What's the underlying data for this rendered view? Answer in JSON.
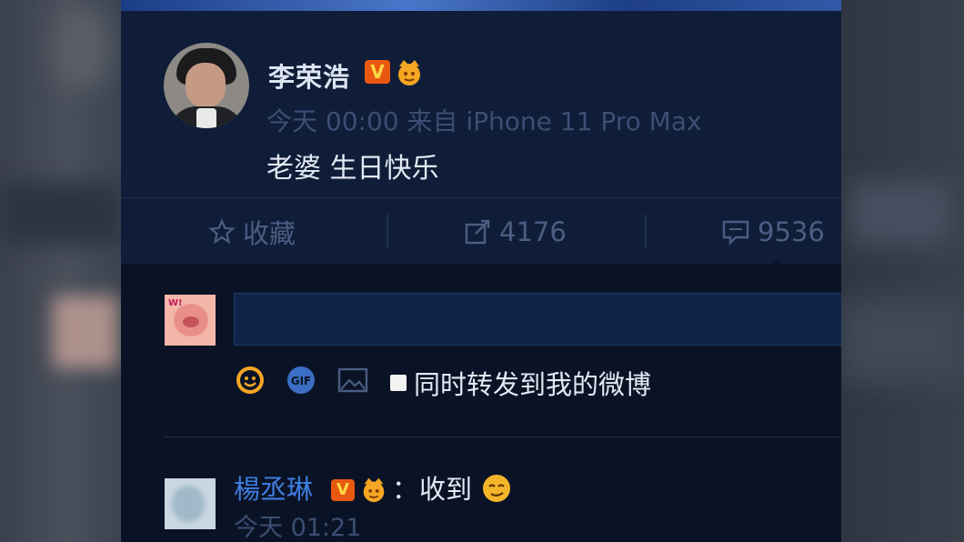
{
  "post": {
    "username": "李荣浩",
    "verified_badge": "V",
    "meta": "今天 00:00 来自 iPhone 11 Pro Max",
    "text": "老婆 生日快乐"
  },
  "actions": {
    "favorite_label": "收藏",
    "repost_count": "4176",
    "comment_count": "9536"
  },
  "composer": {
    "sync_label": "同时转发到我的微博",
    "icons": [
      "emoji-icon",
      "gif-icon",
      "image-icon"
    ]
  },
  "comment": {
    "username": "楊丞琳",
    "verified_badge": "V",
    "colon": "：",
    "text": "收到",
    "time": "今天 01:21"
  },
  "colors": {
    "panel_bg": "#0e1a30",
    "link_blue": "#3f7de0",
    "muted": "#3b4e73",
    "badge_orange": "#e8580f"
  }
}
